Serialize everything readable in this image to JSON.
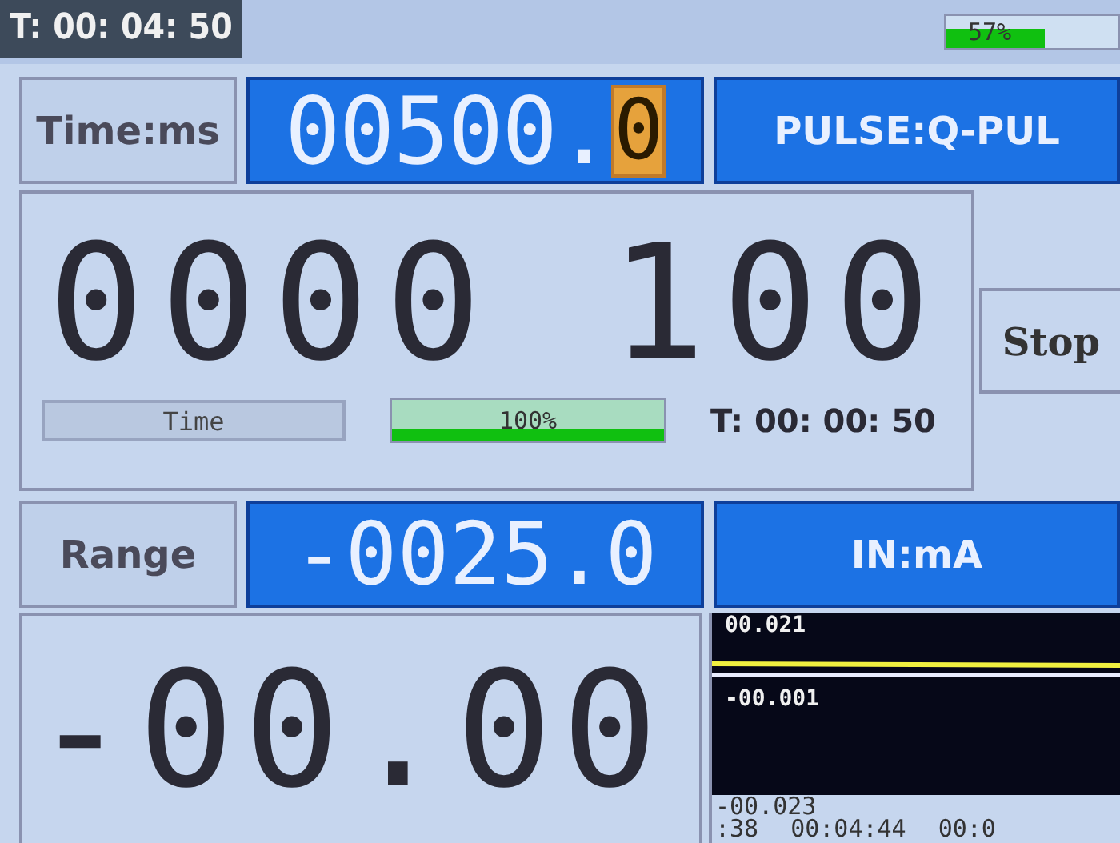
{
  "status_bar": {
    "clock": "T: 00: 04: 50",
    "battery": {
      "level": 0.57,
      "reading": "57%"
    }
  },
  "pulse_row": {
    "label": "Time:ms",
    "value": "00500.",
    "cursor_digit": "0",
    "mode": "PULSE:Q-PUL"
  },
  "counter": {
    "display": "0000 100",
    "time_button": "Time",
    "progress": {
      "level": 1.0,
      "reading": "100%"
    },
    "elapsed": "T: 00: 00: 50"
  },
  "stop_button": "Stop",
  "range_row": {
    "label": "Range",
    "value": "-0025.0",
    "input": "IN:mA"
  },
  "reading": {
    "display": "-00.00"
  },
  "trend": {
    "top_label": "00.021",
    "mid_label": "-00.001",
    "bottom_label": "-00.023",
    "x_labels": [
      ":38",
      "00:04:44",
      "00:0"
    ]
  }
}
